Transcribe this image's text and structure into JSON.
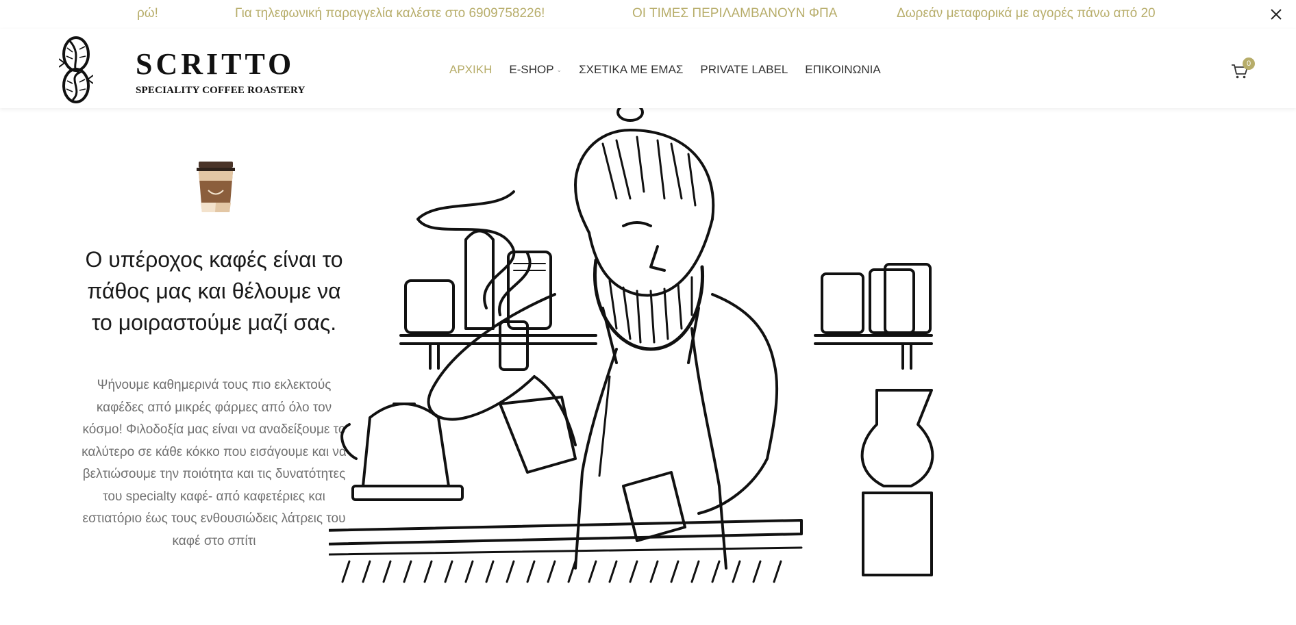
{
  "announcement": {
    "messages": [
      "ρώ!",
      "Για τηλεφωνική παραγγελία καλέστε στο 6909758226!",
      "ΟΙ ΤΙΜΕΣ ΠΕΡΙΛΑΜΒΑΝΟΥΝ ΦΠΑ",
      "Δωρεάν μεταφορικά με αγορές πάνω από 20"
    ],
    "close_icon": "close-icon"
  },
  "header": {
    "brand_name": "SCRITTO",
    "brand_tagline": "SPECIALITY COFFEE ROASTERY",
    "nav": [
      {
        "label": "ΑΡΧΙΚΗ",
        "active": true
      },
      {
        "label": "E-SHOP",
        "has_dropdown": true
      },
      {
        "label": "ΣΧΕΤΙΚΑ ΜΕ ΕΜΑΣ"
      },
      {
        "label": "PRIVATE LABEL"
      },
      {
        "label": "ΕΠΙΚΟΙΝΩΝΙΑ"
      }
    ],
    "cart": {
      "icon": "cart-icon",
      "count": "0"
    }
  },
  "hero": {
    "icon": "coffee-cup-icon",
    "title": "Ο υπέροχος καφές είναι το πάθος μας και θέλουμε να το μοιραστούμε μαζί σας.",
    "text": "Ψήνουμε καθημερινά τους πιο εκλεκτούς καφέδες από μικρές φάρμες από όλο τον κόσμο! Φιλοδοξία μας είναι να αναδείξουμε το καλύτερο σε κάθε κόκκο που εισάγουμε και να βελτιώσουμε την ποιότητα και τις δυνατότητες του specialty καφέ- από καφετέριες και εστιατόριο έως τους ενθουσιώδεις λάτρεις του καφέ στο σπίτι"
  },
  "colors": {
    "accent": "#b7ad6a",
    "text_muted": "#707070",
    "heading": "#1a1a1a"
  }
}
